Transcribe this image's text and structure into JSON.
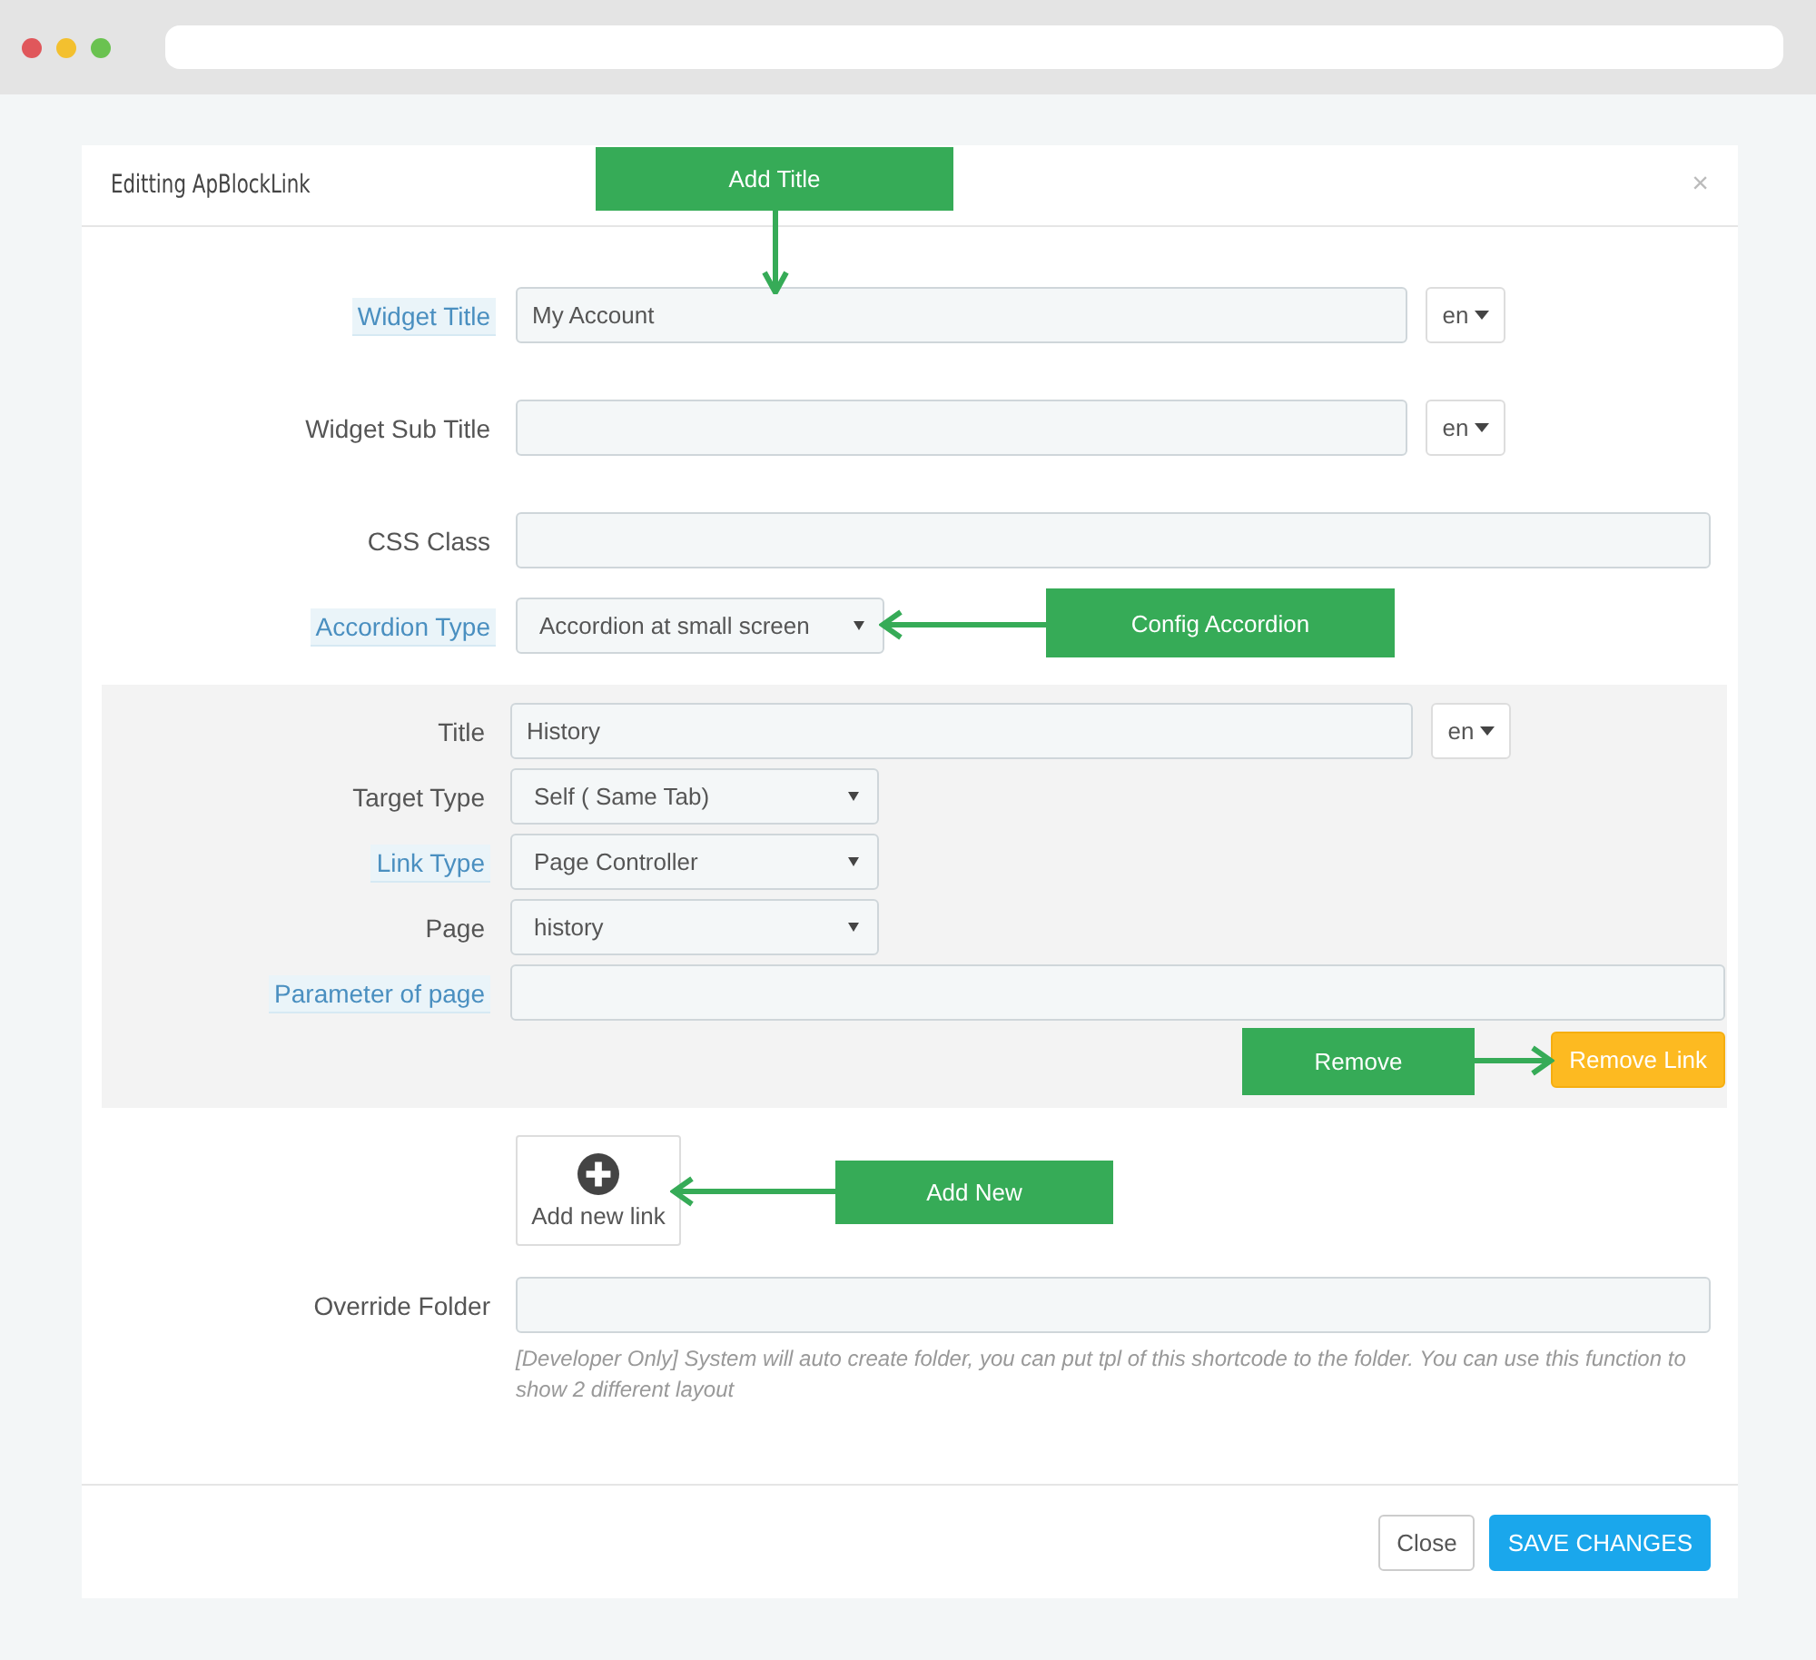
{
  "modal": {
    "title": "Editting ApBlockLink",
    "close": "×"
  },
  "fields": [
    {
      "kind": "text",
      "label": "Widget Title",
      "highlighted": true,
      "value": "My Account",
      "lang": "en"
    },
    {
      "kind": "text",
      "label": "Widget Sub Title",
      "highlighted": false,
      "lang": "en"
    },
    {
      "kind": "text",
      "label": "CSS Class",
      "highlighted": false
    },
    {
      "kind": "select",
      "label": "Accordion Type",
      "highlighted": true,
      "value": "Accordion at small screen"
    }
  ],
  "link_panel": {
    "fields": [
      {
        "kind": "text",
        "label": "Title",
        "highlighted": false,
        "value": "History",
        "lang": "en"
      },
      {
        "kind": "select",
        "label": "Target Type",
        "highlighted": false,
        "value": "Self ( Same Tab)"
      },
      {
        "kind": "select",
        "label": "Link Type",
        "highlighted": true,
        "value": "Page Controller"
      },
      {
        "kind": "select",
        "label": "Page",
        "highlighted": false,
        "value": "history"
      },
      {
        "kind": "text",
        "label": "Parameter of page",
        "highlighted": true
      }
    ],
    "remove_button": "Remove Link"
  },
  "add_new_link": "Add new link",
  "override_folder": {
    "label": "Override Folder",
    "help": "[Developer Only] System will auto create folder, you can put tpl of this shortcode to the folder. You can use this function to show 2 different layout"
  },
  "footer": {
    "buttons": [
      {
        "label": "Close",
        "kind": "default"
      },
      {
        "label": "SAVE CHANGES",
        "kind": "primary"
      }
    ]
  },
  "annotations": [
    {
      "text": "Add Title"
    },
    {
      "text": "Config Accordion"
    },
    {
      "text": "Remove"
    },
    {
      "text": "Add New"
    }
  ]
}
